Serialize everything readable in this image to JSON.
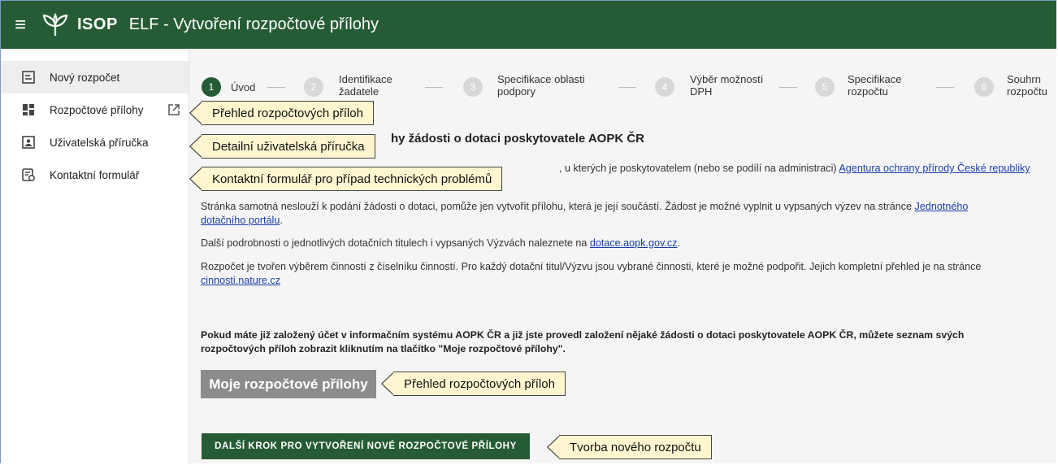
{
  "header": {
    "brand": "ISOP",
    "title": "ELF - Vytvoření rozpočtové přílohy"
  },
  "sidebar": {
    "items": [
      {
        "label": "Nový rozpočet",
        "icon": "new-budget-icon"
      },
      {
        "label": "Rozpočtové přílohy",
        "icon": "grid-icon"
      },
      {
        "label": "Uživatelská příručka",
        "icon": "user-guide-icon"
      },
      {
        "label": "Kontaktní formulář",
        "icon": "contact-form-icon"
      }
    ]
  },
  "stepper": {
    "steps": [
      {
        "number": "1",
        "label": "Úvod",
        "active": true
      },
      {
        "number": "2",
        "label": "Identifikace žadatele",
        "line1": "Identifikace",
        "line2": "žadatele"
      },
      {
        "number": "3",
        "label": "Specifikace oblasti podpory",
        "line1": "Specifikace oblasti",
        "line2": "podpory"
      },
      {
        "number": "4",
        "label": "Výběr možností DPH",
        "line1": "Výběr možností",
        "line2": "DPH"
      },
      {
        "number": "5",
        "label": "Specifikace rozpočtu",
        "line1": "Specifikace",
        "line2": "rozpočtu"
      },
      {
        "number": "6",
        "label": "Souhrn rozpočtu",
        "line1": "Souhrn",
        "line2": "rozpočtu"
      }
    ]
  },
  "content": {
    "heading_visible": "hy žádosti o dotaci poskytovatele AOPK ČR",
    "p1_visible": ", u kterých je poskytovatelem (nebo se podílí na administraci)",
    "p1_link": "Agentura ochrany přírody České republiky",
    "p2_text": "Stránka samotná neslouží k podání žádosti o dotaci, pomůže jen vytvořit přílohu, která je její součástí. Žádost je možné vyplnit u vypsaných výzev na stránce",
    "p2_link_a": "Jednotného",
    "p2_link_b": "dotačního portálu",
    "p3_text": "Další podrobnosti o jednotlivých dotačních titulech i vypsaných Výzvách naleznete na",
    "p3_link": "dotace.aopk.gov.cz",
    "p4_text": "Rozpočet je tvořen výběrem činností z číselníku činností. Pro každý dotační titul/Výzvu jsou vybrané činnosti, které je možné podpořit. Jejich kompletní přehled je na stránce",
    "p4_link": "cinnosti.nature.cz",
    "bold_line1": "Pokud máte již založený účet v informačním systému AOPK ČR a již jste provedl založení nějaké žádosti o dotaci poskytovatele AOPK ČR, můžete seznam svých",
    "bold_line2": "rozpočtových příloh zobrazit kliknutím na tlačítko \"Moje rozpočtové přílohy\".",
    "my_attachments_button": "Moje rozpočtové přílohy",
    "next_step_button": "DALŠÍ KROK PRO VYTVOŘENÍ NOVÉ ROZPOČTOVÉ PŘÍLOHY"
  },
  "callouts": {
    "attachments_overview": "Přehled rozpočtových příloh",
    "user_guide": "Detailní uživatelská příručka",
    "contact_form": "Kontaktní formulář pro případ technických problémů",
    "button_overview": "Přehled rozpočtových příloh",
    "new_budget": "Tvorba nového rozpočtu"
  },
  "colors": {
    "header_green": "#265c35",
    "link_blue": "#1a3fa8",
    "callout_fill": "#fff6d0",
    "grey_button": "#8c8c8c"
  }
}
